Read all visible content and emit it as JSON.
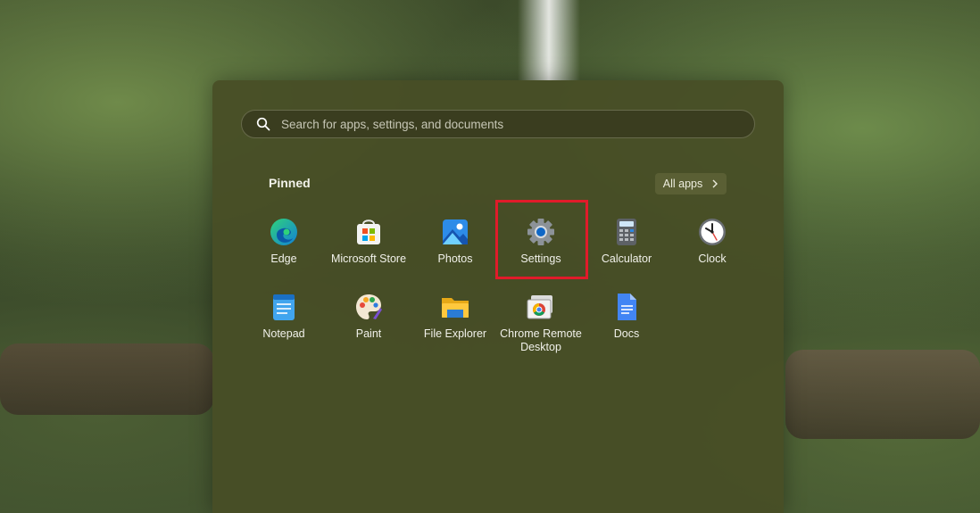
{
  "search": {
    "placeholder": "Search for apps, settings, and documents"
  },
  "pinned": {
    "label": "Pinned",
    "all_apps_label": "All apps"
  },
  "apps": [
    {
      "label": "Edge",
      "icon": "edge-icon"
    },
    {
      "label": "Microsoft Store",
      "icon": "store-icon"
    },
    {
      "label": "Photos",
      "icon": "photos-icon"
    },
    {
      "label": "Settings",
      "icon": "gear-icon",
      "highlighted": true
    },
    {
      "label": "Calculator",
      "icon": "calculator-icon"
    },
    {
      "label": "Clock",
      "icon": "clock-icon"
    },
    {
      "label": "Notepad",
      "icon": "notepad-icon"
    },
    {
      "label": "Paint",
      "icon": "paint-icon"
    },
    {
      "label": "File Explorer",
      "icon": "folder-icon"
    },
    {
      "label_line1": "Chrome Remote",
      "label_line2": "Desktop",
      "icon": "chrome-remote-desktop-icon"
    },
    {
      "label": "Docs",
      "icon": "docs-icon"
    }
  ],
  "colors": {
    "highlight": "#e11b2a",
    "panel": "#484e26"
  }
}
